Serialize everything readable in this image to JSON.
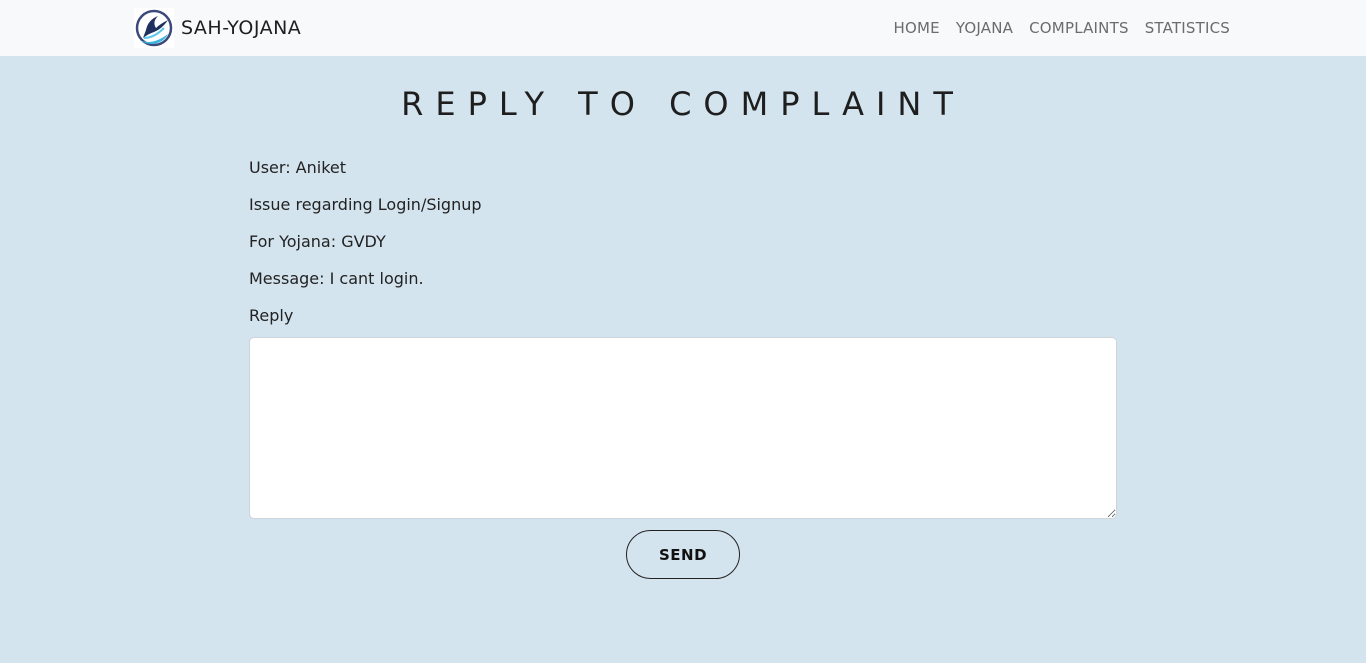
{
  "navbar": {
    "brand": "SAH-YOJANA",
    "logo_icon": "quill-feather-logo-icon",
    "links": [
      "HOME",
      "YOJANA",
      "COMPLAINTS",
      "STATISTICS"
    ]
  },
  "page": {
    "title": "REPLY TO COMPLAINT"
  },
  "complaint": {
    "user": "User: Aniket",
    "issue": "Issue regarding Login/Signup",
    "yojana": "For Yojana: GVDY",
    "message": "Message: I cant login."
  },
  "reply": {
    "label": "Reply",
    "value": "",
    "send_label": "SEND"
  },
  "colors": {
    "background": "#d4e4ef",
    "navbar": "#f8f9fa",
    "accent": "#3aa8d8"
  }
}
